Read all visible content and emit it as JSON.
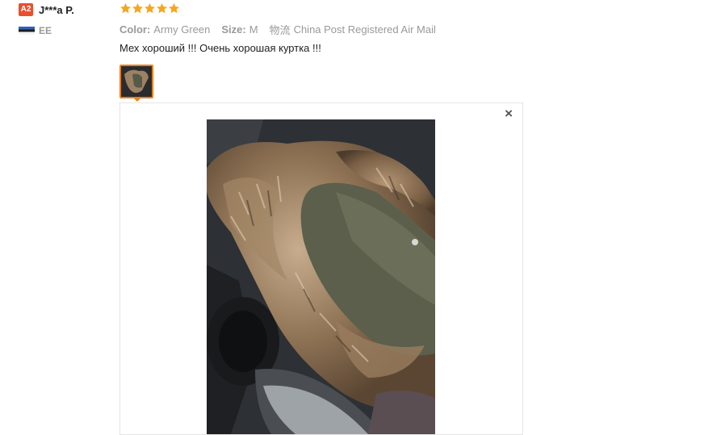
{
  "user": {
    "level_badge": "A2",
    "name": "J***a P.",
    "country_code": "EE"
  },
  "review": {
    "rating": 5,
    "rating_max": 5,
    "star_color": "#f5a623",
    "color_label": "Color:",
    "color_value": "Army Green",
    "size_label": "Size:",
    "size_value": "M",
    "shipping_label": "物流",
    "shipping_value": "China Post Registered Air Mail",
    "comment": "Мех хороший !!! Очень хорошая куртка !!!"
  },
  "viewer": {
    "close_glyph": "×"
  },
  "colors": {
    "accent": "#e8811a",
    "badge": "#e8502f"
  }
}
